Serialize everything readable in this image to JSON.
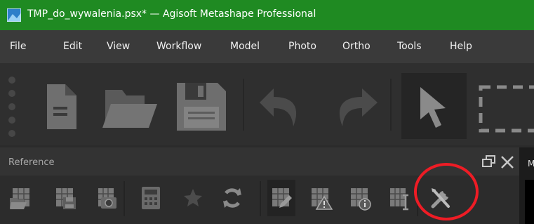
{
  "window": {
    "title": "TMP_do_wywalenia.psx* — Agisoft Metashape Professional"
  },
  "menu": [
    {
      "label": "File",
      "name": "menu-file"
    },
    {
      "label": "Edit",
      "name": "menu-edit"
    },
    {
      "label": "View",
      "name": "menu-view"
    },
    {
      "label": "Workflow",
      "name": "menu-workflow"
    },
    {
      "label": "Model",
      "name": "menu-model"
    },
    {
      "label": "Photo",
      "name": "menu-photo"
    },
    {
      "label": "Ortho",
      "name": "menu-ortho"
    },
    {
      "label": "Tools",
      "name": "menu-tools"
    },
    {
      "label": "Help",
      "name": "menu-help"
    }
  ],
  "main_toolbar": {
    "icons": [
      "new-document-icon",
      "open-folder-icon",
      "save-icon",
      "undo-icon",
      "redo-icon",
      "navigation-arrow-icon",
      "rectangle-selection-icon"
    ]
  },
  "reference_panel": {
    "title": "Reference",
    "icons": [
      "import-reference-icon",
      "export-reference-icon",
      "convert-reference-icon",
      "calculator-icon",
      "star-icon",
      "update-icon",
      "edit-reference-icon",
      "view-errors-icon",
      "view-estimated-icon",
      "view-source-icon",
      "reference-settings-icon"
    ]
  },
  "right_strip": {
    "text": "M"
  },
  "colors": {
    "titlebar": "#1f8a22",
    "highlight_circle": "#ee1c25"
  }
}
